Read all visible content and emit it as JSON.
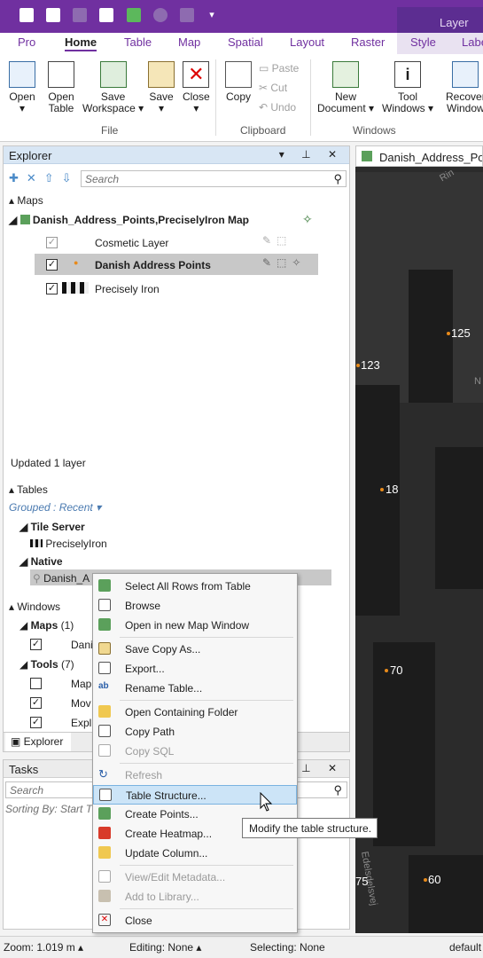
{
  "ribbon": {
    "context_tab": "Layer",
    "tabs": [
      "Pro",
      "Home",
      "Table",
      "Map",
      "Spatial",
      "Layout",
      "Raster",
      "Style",
      "Label"
    ],
    "active_tab": "Home",
    "buttons": {
      "open": "Open",
      "open_table_1": "Open",
      "open_table_2": "Table",
      "save_ws_1": "Save",
      "save_ws_2": "Workspace",
      "save": "Save",
      "close": "Close",
      "copy": "Copy",
      "paste": "Paste",
      "cut": "Cut",
      "undo": "Undo",
      "new_doc_1": "New",
      "new_doc_2": "Document",
      "tool_win_1": "Tool",
      "tool_win_2": "Windows",
      "recover_1": "Recover",
      "recover_2": "Window"
    },
    "groups": {
      "file": "File",
      "clipboard": "Clipboard",
      "windows": "Windows"
    }
  },
  "explorer": {
    "title": "Explorer",
    "search_placeholder": "Search",
    "maps_header": "Maps",
    "map_name": "Danish_Address_Points,PreciselyIron Map",
    "layers": [
      {
        "label": "Cosmetic Layer",
        "checked": true
      },
      {
        "label": "Danish Address Points",
        "checked": true
      },
      {
        "label": "Precisely Iron",
        "checked": true
      }
    ],
    "status": "Updated 1 layer",
    "tables_header": "Tables",
    "grouped": "Grouped : Recent",
    "tile_server": "Tile Server",
    "tile_table": "PreciselyIron",
    "native": "Native",
    "native_table": "Danish_A",
    "windows_header": "Windows",
    "maps_group": "Maps",
    "maps_count": "(1)",
    "map_win": "Dani",
    "tools_group": "Tools",
    "tools_count": "(7)",
    "tool1": "Map",
    "tool2": "Mov",
    "tool3": "Expl"
  },
  "bottom_tabs": {
    "explorer": "Explorer"
  },
  "tasks": {
    "title": "Tasks",
    "search_placeholder": "Search",
    "sorting": "Sorting By: Start Ti"
  },
  "map": {
    "tab_title": "Danish_Address_Poi",
    "labels": [
      "125",
      "123",
      "18",
      "70",
      "60",
      "75"
    ],
    "roads": [
      "Rin",
      "N",
      "Edelsdelsvej"
    ]
  },
  "context_menu": {
    "items": [
      "Select All Rows from Table",
      "Browse",
      "Open in new Map Window",
      "Save Copy As...",
      "Export...",
      "Rename Table...",
      "Open Containing Folder",
      "Copy Path",
      "Copy SQL",
      "Refresh",
      "Table Structure...",
      "Create Points...",
      "Create Heatmap...",
      "Update Column...",
      "View/Edit Metadata...",
      "Add to Library...",
      "Close"
    ],
    "highlighted": "Table Structure..."
  },
  "tooltip": "Modify the table structure.",
  "status": {
    "zoom": "Zoom: 1.019 m",
    "editing": "Editing: None",
    "selecting": "Selecting: None",
    "default": "default"
  },
  "colors": {
    "accent": "#7030a0",
    "selection": "#cce4f7",
    "map_bg": "#2b2b2b",
    "point": "#e88a1a"
  }
}
